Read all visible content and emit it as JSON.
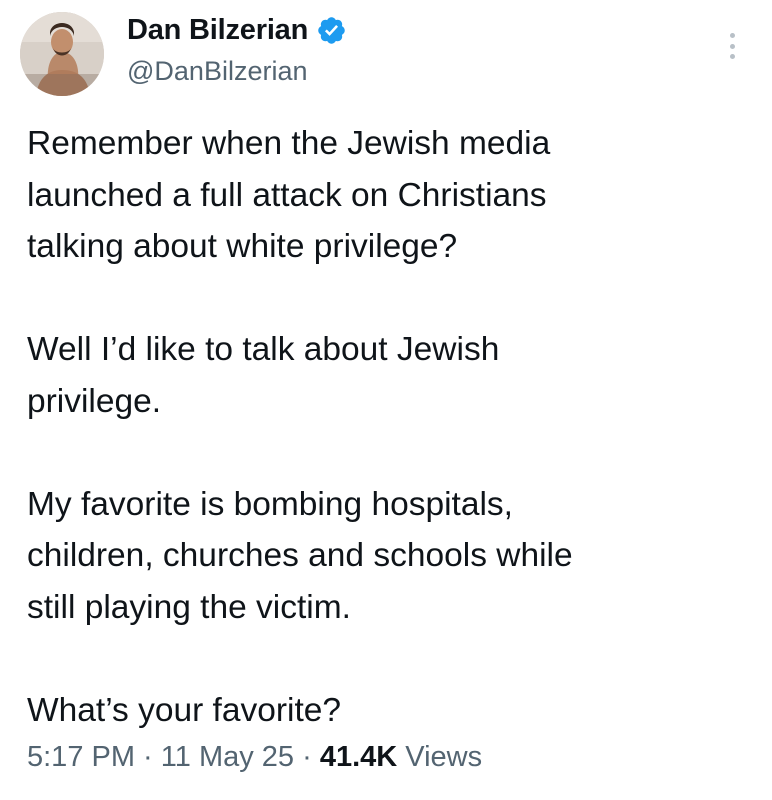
{
  "author": {
    "display_name": "Dan Bilzerian",
    "handle": "@DanBilzerian",
    "verified_color": "#1d9bf0"
  },
  "tweet": {
    "paragraphs": [
      "Remember when the Jewish media\nlaunched a full attack on Christians\ntalking about white privilege?",
      "Well I’d like to talk about Jewish\nprivilege.",
      "My favorite is bombing hospitals,\nchildren, churches and schools while\nstill playing the victim.",
      "What’s your favorite?"
    ]
  },
  "meta": {
    "time": "5:17 PM",
    "separator": " · ",
    "date": "11 May 25",
    "views_count": "41.4K",
    "views_label": " Views"
  }
}
